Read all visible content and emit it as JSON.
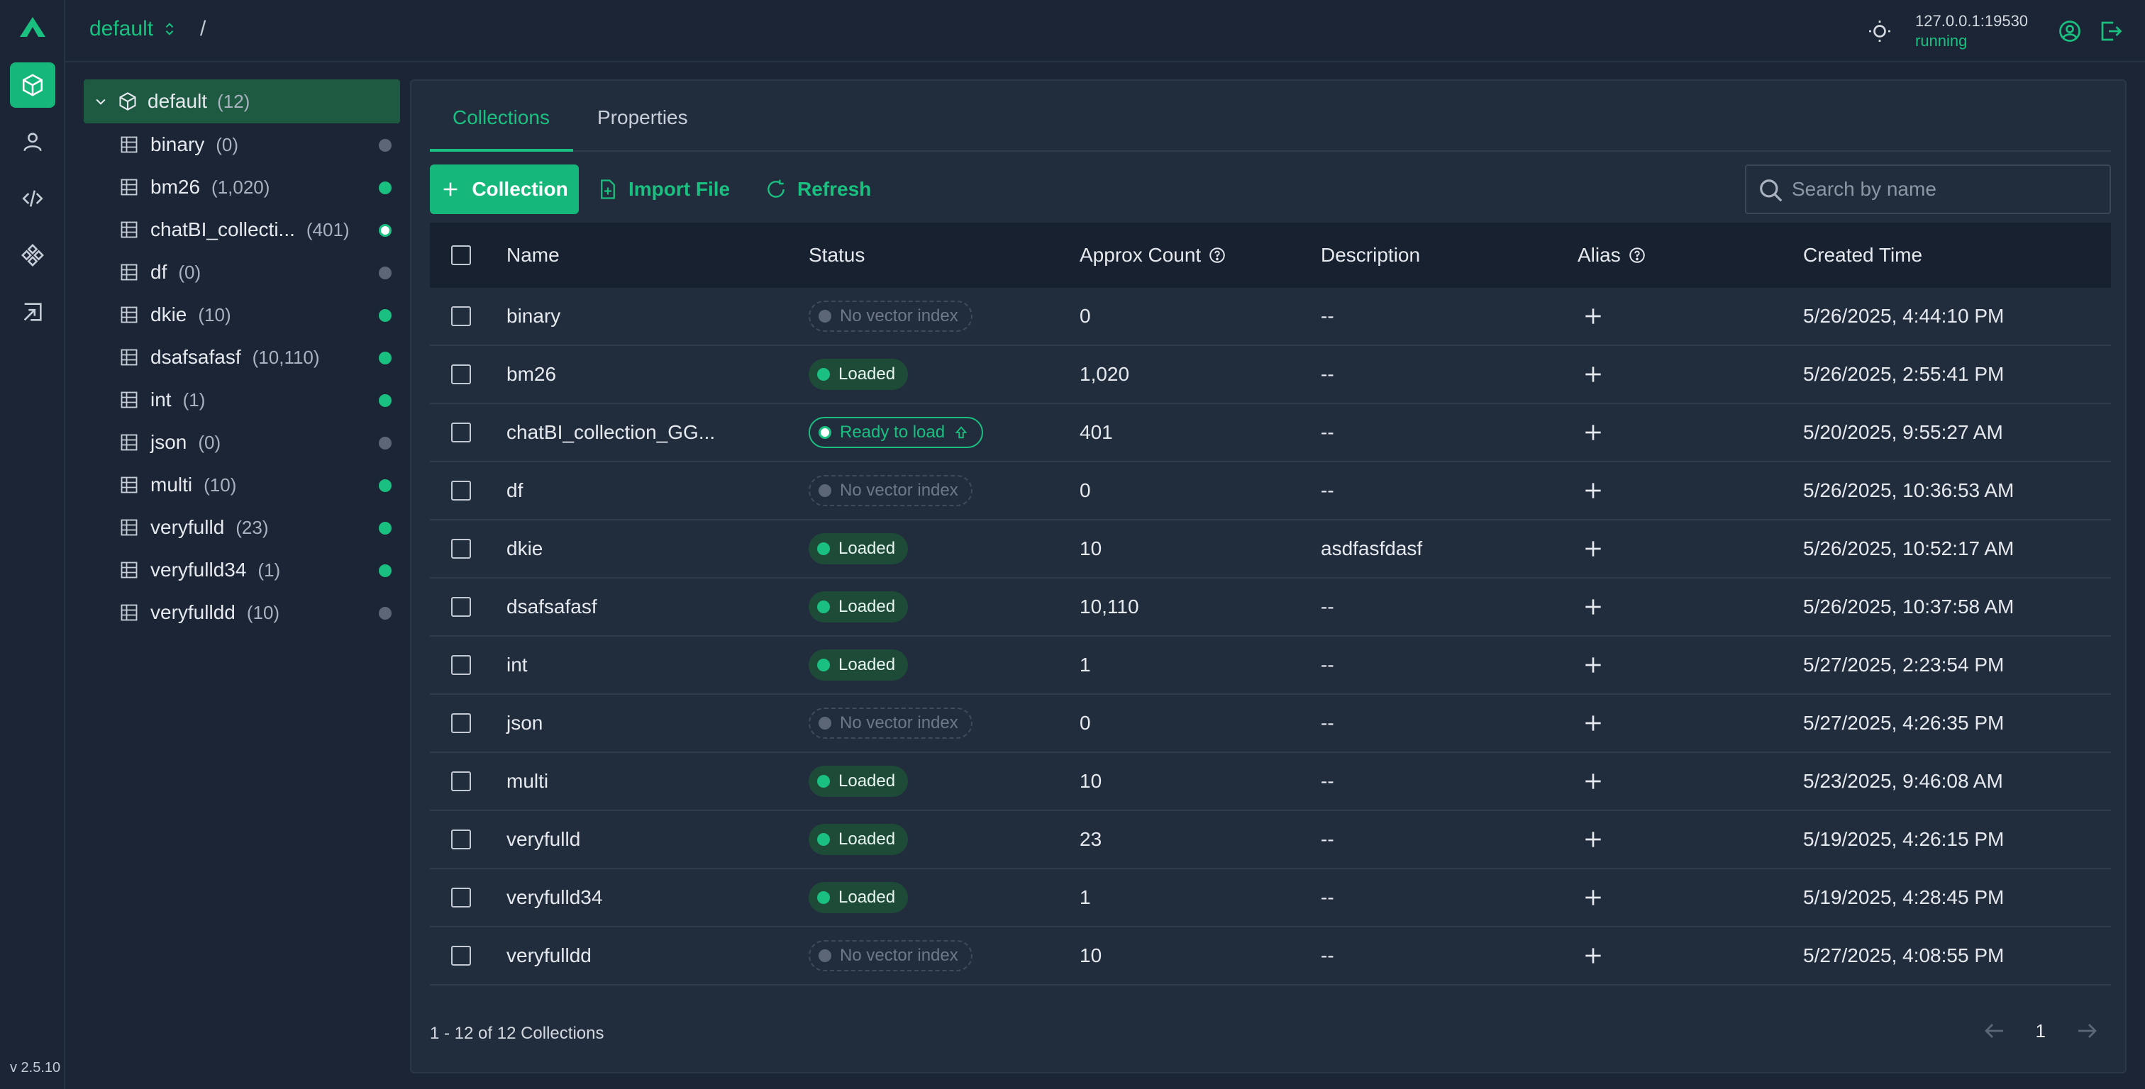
{
  "app": {
    "version": "v 2.5.10",
    "database": "default",
    "breadcrumb_sep": "/",
    "connection": {
      "address": "127.0.0.1:19530",
      "status": "running"
    }
  },
  "colors": {
    "accent": "#19c07f",
    "background": "#1b2536",
    "panel": "#212c3d"
  },
  "rail": {
    "items": [
      {
        "icon": "cube-icon",
        "active": true
      },
      {
        "icon": "user-icon",
        "active": false
      },
      {
        "icon": "code-icon",
        "active": false
      },
      {
        "icon": "diamond-grid-icon",
        "active": false
      },
      {
        "icon": "external-box-icon",
        "active": false
      }
    ]
  },
  "tree": {
    "root": {
      "label": "default",
      "count": "(12)"
    },
    "items": [
      {
        "label": "binary",
        "count": "(0)",
        "status": "gray"
      },
      {
        "label": "bm26",
        "count": "(1,020)",
        "status": "green"
      },
      {
        "label": "chatBI_collecti...",
        "count": "(401)",
        "status": "white"
      },
      {
        "label": "df",
        "count": "(0)",
        "status": "gray"
      },
      {
        "label": "dkie",
        "count": "(10)",
        "status": "green"
      },
      {
        "label": "dsafsafasf",
        "count": "(10,110)",
        "status": "green"
      },
      {
        "label": "int",
        "count": "(1)",
        "status": "green"
      },
      {
        "label": "json",
        "count": "(0)",
        "status": "gray"
      },
      {
        "label": "multi",
        "count": "(10)",
        "status": "green"
      },
      {
        "label": "veryfulld",
        "count": "(23)",
        "status": "green"
      },
      {
        "label": "veryfulld34",
        "count": "(1)",
        "status": "green"
      },
      {
        "label": "veryfulldd",
        "count": "(10)",
        "status": "gray"
      }
    ]
  },
  "tabs": [
    {
      "label": "Collections",
      "active": true
    },
    {
      "label": "Properties",
      "active": false
    }
  ],
  "toolbar": {
    "create_label": "Collection",
    "import_label": "Import File",
    "refresh_label": "Refresh",
    "search_placeholder": "Search by name"
  },
  "table": {
    "columns": [
      "Name",
      "Status",
      "Approx Count",
      "Description",
      "Alias",
      "Created Time"
    ],
    "rows": [
      {
        "name": "binary",
        "status": "No vector index",
        "count": "0",
        "description": "--",
        "created": "5/26/2025, 4:44:10 PM"
      },
      {
        "name": "bm26",
        "status": "Loaded",
        "count": "1,020",
        "description": "--",
        "created": "5/26/2025, 2:55:41 PM"
      },
      {
        "name": "chatBI_collection_GG...",
        "status": "Ready to load",
        "count": "401",
        "description": "--",
        "created": "5/20/2025, 9:55:27 AM"
      },
      {
        "name": "df",
        "status": "No vector index",
        "count": "0",
        "description": "--",
        "created": "5/26/2025, 10:36:53 AM"
      },
      {
        "name": "dkie",
        "status": "Loaded",
        "count": "10",
        "description": "asdfasfdasf",
        "created": "5/26/2025, 10:52:17 AM"
      },
      {
        "name": "dsafsafasf",
        "status": "Loaded",
        "count": "10,110",
        "description": "--",
        "created": "5/26/2025, 10:37:58 AM"
      },
      {
        "name": "int",
        "status": "Loaded",
        "count": "1",
        "description": "--",
        "created": "5/27/2025, 2:23:54 PM"
      },
      {
        "name": "json",
        "status": "No vector index",
        "count": "0",
        "description": "--",
        "created": "5/27/2025, 4:26:35 PM"
      },
      {
        "name": "multi",
        "status": "Loaded",
        "count": "10",
        "description": "--",
        "created": "5/23/2025, 9:46:08 AM"
      },
      {
        "name": "veryfulld",
        "status": "Loaded",
        "count": "23",
        "description": "--",
        "created": "5/19/2025, 4:26:15 PM"
      },
      {
        "name": "veryfulld34",
        "status": "Loaded",
        "count": "1",
        "description": "--",
        "created": "5/19/2025, 4:28:45 PM"
      },
      {
        "name": "veryfulldd",
        "status": "No vector index",
        "count": "10",
        "description": "--",
        "created": "5/27/2025, 4:08:55 PM"
      }
    ]
  },
  "footer": {
    "summary": "1 - 12 of 12 Collections",
    "page": "1"
  }
}
